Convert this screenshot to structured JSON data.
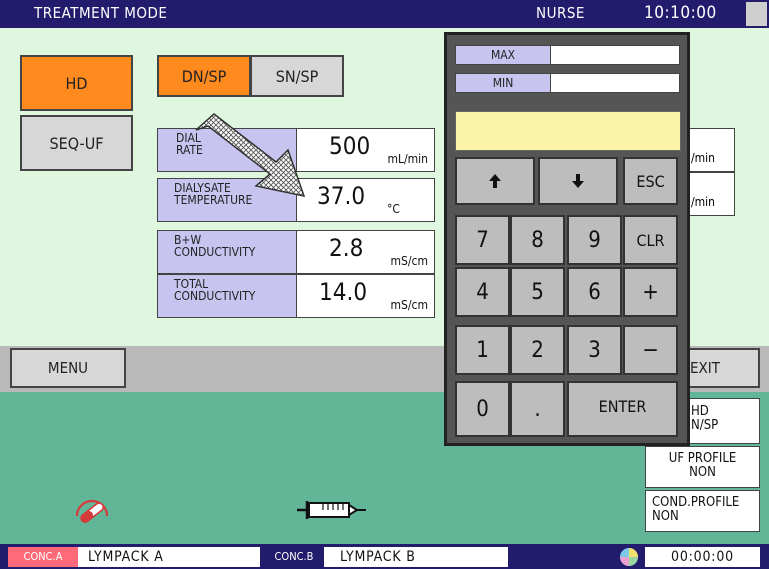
{
  "header": {
    "title": "TREATMENT MODE",
    "user": "NURSE",
    "clock": "10:10:00"
  },
  "mode_buttons": {
    "hd": "HD",
    "seq_uf": "SEQ-UF",
    "dn_sp": "DN/SP",
    "sn_sp": "SN/SP"
  },
  "params": {
    "dialysate_rate": {
      "label": "DIALYSATE RATE",
      "label_visible": "DIAL\nRATE",
      "value": "500",
      "unit": "mL/min"
    },
    "dialysate_temp": {
      "label": "DIALYSATE\nTEMPERATURE",
      "value": "37.0",
      "unit": "°C"
    },
    "bw_cond": {
      "label": "B+W\nCONDUCTIVITY",
      "value": "2.8",
      "unit": "mS/cm"
    },
    "total_cond": {
      "label": "TOTAL\nCONDUCTIVITY",
      "value": "14.0",
      "unit": "mS/cm"
    }
  },
  "partial_right": {
    "a": "/min",
    "b": "/min"
  },
  "keypad": {
    "max_label": "MAX",
    "min_label": "MIN",
    "max_value": "",
    "min_value": "",
    "display": "",
    "keys": {
      "up": "⬆",
      "down": "⬇",
      "esc": "ESC",
      "k7": "7",
      "k8": "8",
      "k9": "9",
      "clr": "CLR",
      "k4": "4",
      "k5": "5",
      "k6": "6",
      "plus": "+",
      "k1": "1",
      "k2": "2",
      "k3": "3",
      "minus": "−",
      "k0": "0",
      "dot": ".",
      "enter": "ENTER"
    }
  },
  "menu": {
    "menu_label": "MENU",
    "exit_label": "EXIT"
  },
  "status": {
    "mode_line1": "HD",
    "mode_line2": "N/SP",
    "uf_profile": "UF PROFILE",
    "uf_profile_value": "NON",
    "cond_profile": "COND.PROFILE",
    "cond_profile_value": "NON"
  },
  "footer": {
    "conc_a_tag": "CONC.A",
    "conc_a_value": "LYMPACK A",
    "conc_b_tag": "CONC.B",
    "conc_b_value": "LYMPACK B",
    "timer": "00:00:00"
  },
  "colors": {
    "header_bg": "#231b6b",
    "main_bg": "#dff7df",
    "lower_bg": "#62b698",
    "active_orange": "#ff8a1e",
    "label_lavender": "#c8c4f0",
    "conc_a_tag": "#ff6a7a"
  },
  "icons": {
    "arrow_overlay": "hatched-arrow-icon",
    "gauge": "gauge-icon",
    "syringe": "syringe-icon",
    "color_wheel": "color-wheel-icon"
  }
}
